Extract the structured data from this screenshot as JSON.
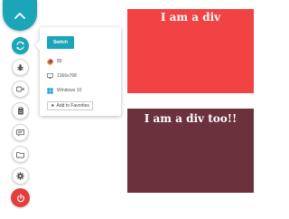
{
  "toolbar": {
    "top_button_icon": "chevron-up-icon",
    "items": [
      {
        "icon": "switch-sync-icon",
        "active": true
      },
      {
        "icon": "bug-icon"
      },
      {
        "icon": "video-icon"
      },
      {
        "icon": "clipboard-icon"
      },
      {
        "icon": "chat-icon"
      },
      {
        "icon": "folder-icon"
      },
      {
        "icon": "gear-icon"
      },
      {
        "icon": "power-icon"
      }
    ]
  },
  "panel": {
    "switch_label": "Switch",
    "browser_version": "89",
    "resolution": "1366x768",
    "os": "Windows 10",
    "favorites_label": "Add to Favorites"
  },
  "content": {
    "div1_text": "I am a div",
    "div2_text": "I am a div too!!"
  },
  "colors": {
    "accent": "#1aa5b8",
    "power": "#e43d3d",
    "div1_bg": "#f14343",
    "div2_bg": "#6b313d"
  }
}
